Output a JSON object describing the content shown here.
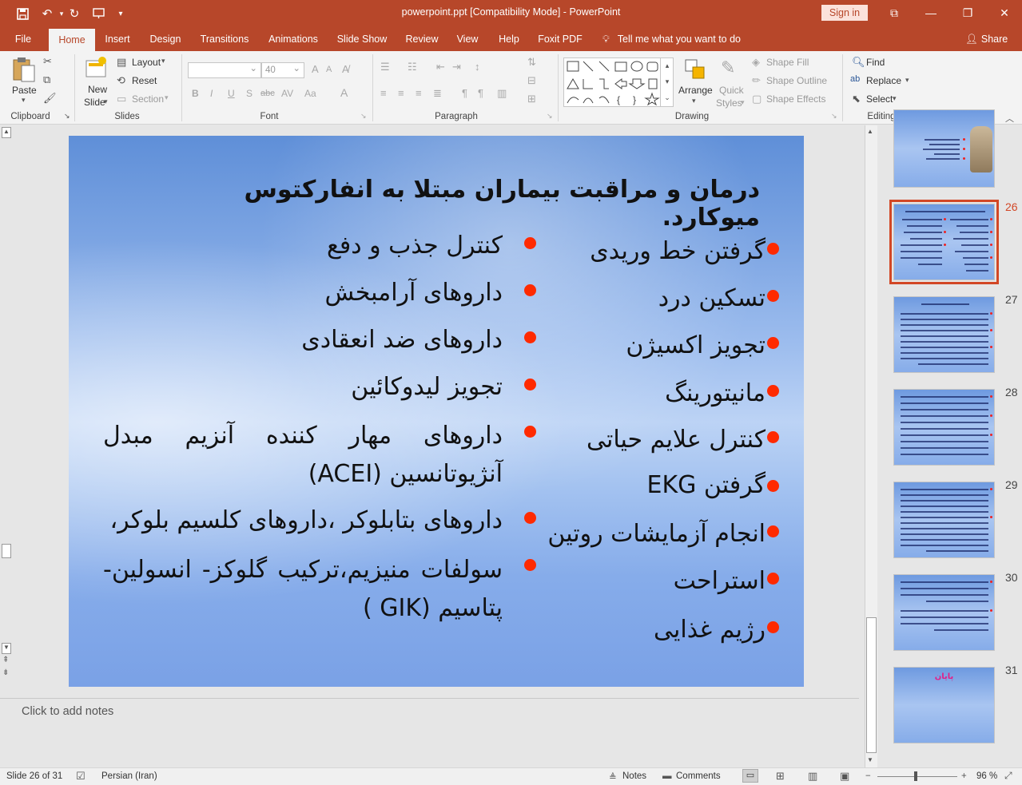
{
  "titlebar": {
    "title": "powerpoint.ppt [Compatibility Mode]  -  PowerPoint",
    "sign_in": "Sign in",
    "qat": [
      "save-icon",
      "undo-icon",
      "redo-icon",
      "present-icon",
      "customize-icon"
    ]
  },
  "tabs": {
    "items": [
      "File",
      "Home",
      "Insert",
      "Design",
      "Transitions",
      "Animations",
      "Slide Show",
      "Review",
      "View",
      "Help",
      "Foxit PDF"
    ],
    "active": "Home",
    "tell_me": "Tell me what you want to do",
    "share": "Share"
  },
  "ribbon": {
    "clipboard": {
      "paste": "Paste",
      "label": "Clipboard"
    },
    "slides": {
      "new_slide_1": "New",
      "new_slide_2": "Slide",
      "layout": "Layout",
      "reset": "Reset",
      "section": "Section",
      "label": "Slides"
    },
    "font": {
      "font_name": "",
      "font_size": "40",
      "label": "Font",
      "bold": "B",
      "italic": "I",
      "underline": "U",
      "shadow": "S",
      "strike": "abc",
      "case": "Aa"
    },
    "paragraph": {
      "label": "Paragraph"
    },
    "drawing": {
      "arrange": "Arrange",
      "quick_styles_1": "Quick",
      "quick_styles_2": "Styles",
      "shape_fill": "Shape Fill",
      "shape_outline": "Shape Outline",
      "shape_effects": "Shape Effects",
      "label": "Drawing"
    },
    "editing": {
      "find": "Find",
      "replace": "Replace",
      "select": "Select",
      "label": "Editing"
    }
  },
  "slide": {
    "title": "درمان و مراقبت بیماران مبتلا به انفارکتوس میوکارد.",
    "right_column": [
      "گرفتن خط وریدی",
      "تسکین درد",
      "تجویز اکسیژن",
      "مانیتورینگ",
      "کنترل علایم حیاتی",
      "گرفتن EKG",
      "انجام آزمایشات روتین",
      "استراحت",
      "رژیم غذایی"
    ],
    "left_column": [
      "کنترل جذب و دفع",
      "داروهای آرامبخش",
      "داروهای ضد انعقادی",
      "تجویز لیدوکائین",
      "داروهای مهار کننده آنزیم مبدل آنژیوتانسین (ACEI)",
      "داروهای بتابلوکر ،داروهای کلسیم بلوکر،",
      "سولفات منیزیم،ترکیب گلوکز- انسولین- پتاسیم (GIK )"
    ],
    "bullet_color": "#ff2a00"
  },
  "notes_placeholder": "Click to add notes",
  "thumbnails": {
    "numbers": [
      "26",
      "27",
      "28",
      "29",
      "30",
      "31"
    ],
    "selected": "26",
    "last_title": "پایان"
  },
  "status": {
    "slide_info": "Slide 26 of 31",
    "language": "Persian (Iran)",
    "notes": "Notes",
    "comments": "Comments",
    "zoom": "96 %"
  },
  "colors": {
    "accent": "#b7472a",
    "selection": "#d24726"
  }
}
